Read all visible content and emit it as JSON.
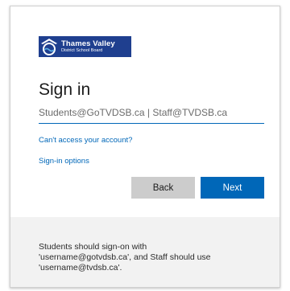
{
  "logo": {
    "line1": "Thames Valley",
    "line2": "District School Board",
    "icon": "tvdsb-logo-icon"
  },
  "title": "Sign in",
  "username_input": {
    "placeholder": "Students@GoTVDSB.ca | Staff@TVDSB.ca",
    "value": ""
  },
  "links": {
    "cant_access": "Can't access your account?",
    "sign_in_options": "Sign-in options"
  },
  "buttons": {
    "back": "Back",
    "next": "Next"
  },
  "notice": {
    "text": "Students should sign-on with\n'username@gotvdsb.ca', and Staff should use\n'username@tvdsb.ca'."
  },
  "colors": {
    "accent": "#0067b8",
    "logo_bg": "#1f3f8f",
    "notice_bg": "#f2f2f2",
    "back_button_bg": "#cccccc"
  }
}
